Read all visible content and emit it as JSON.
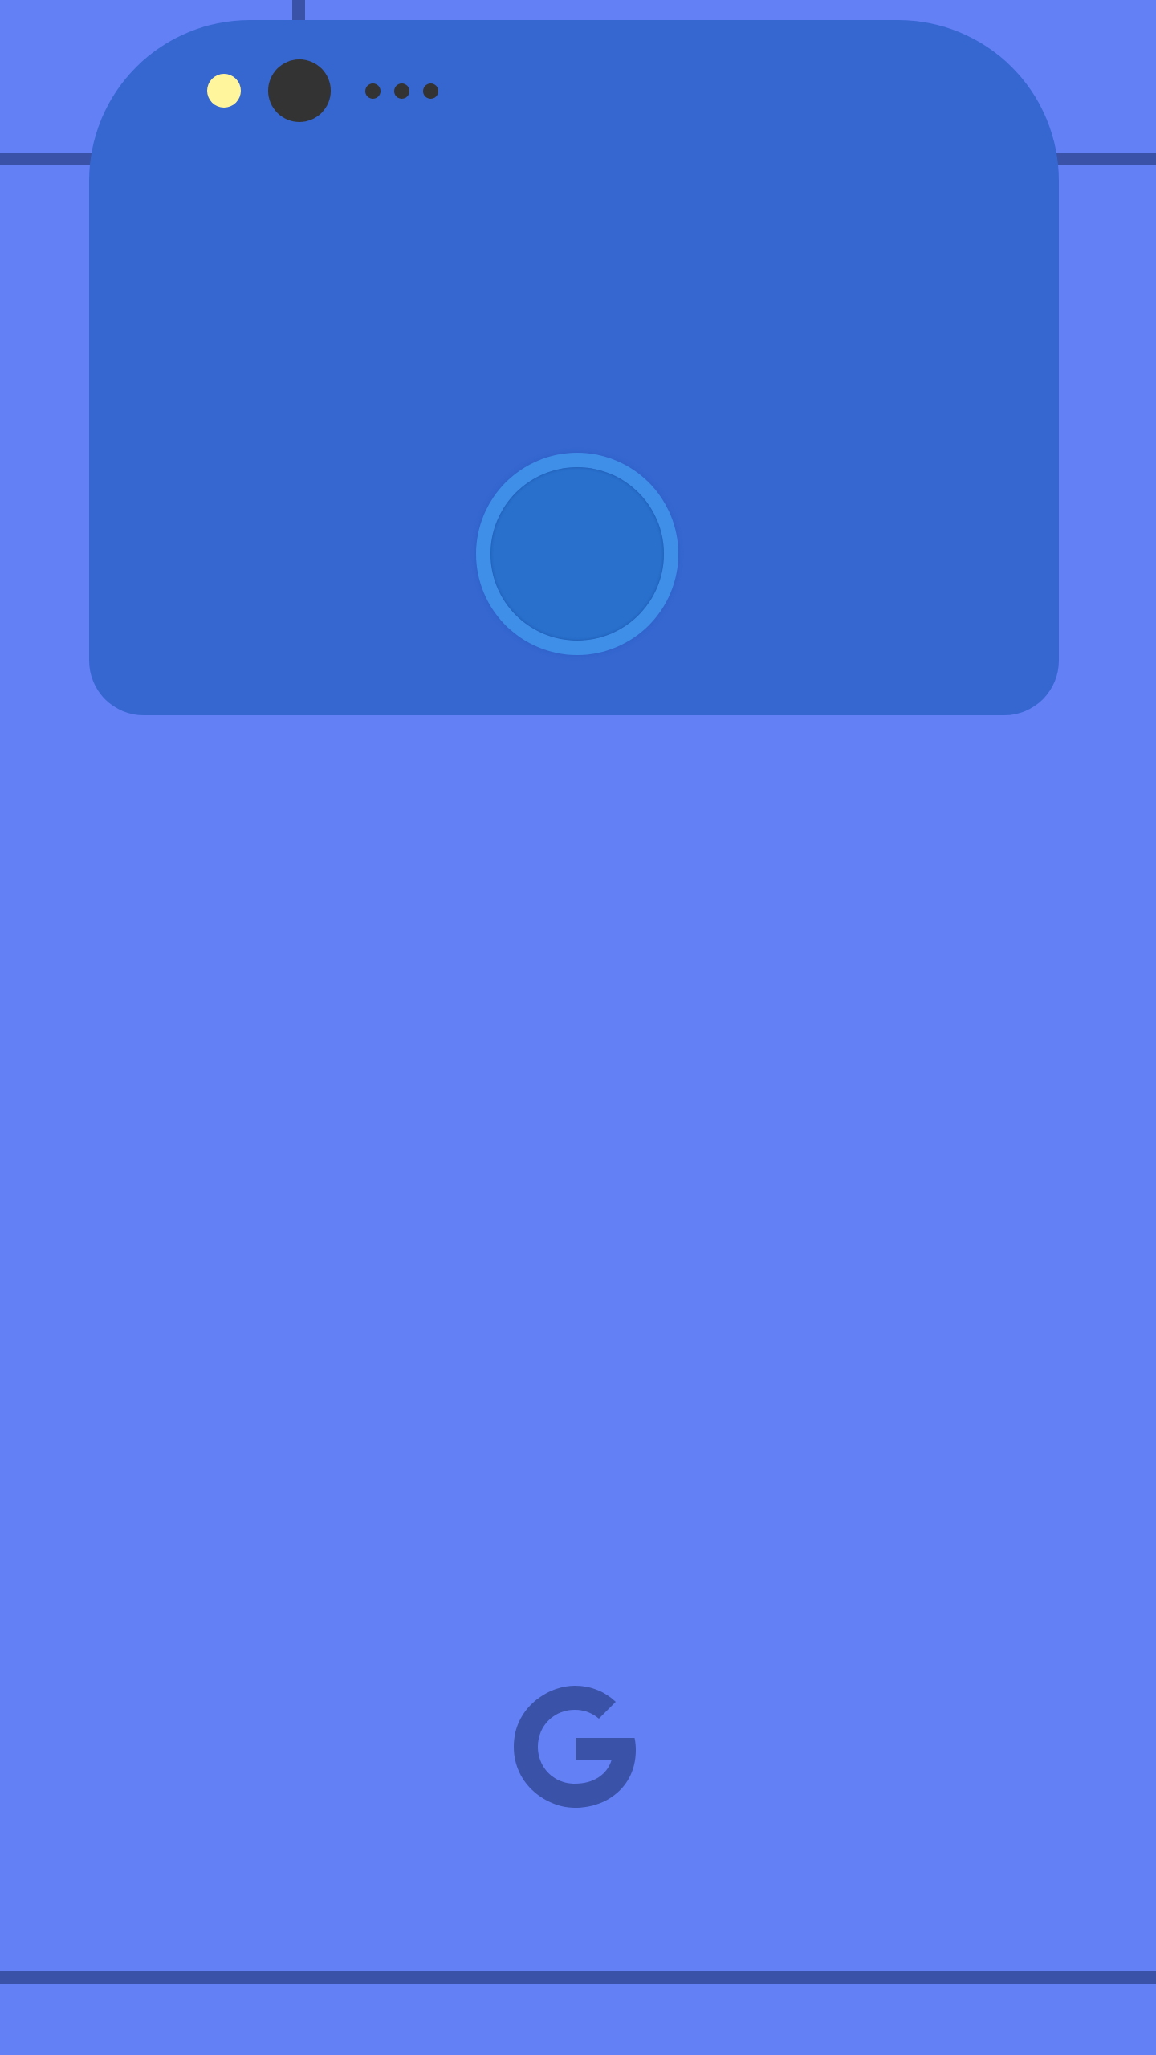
{
  "scene": {
    "description_none": "",
    "colors": {
      "background": "#6380f5",
      "glass_panel": "#3667d1",
      "accent_lines": "#3a52a8",
      "flash": "#fff59d",
      "camera": "#333333",
      "fingerprint_sensor": "#2870cc",
      "logo": "#3a52a8"
    },
    "icons": {
      "logo": "google-g-icon",
      "camera": "camera-lens-icon",
      "flash": "flash-icon",
      "fingerprint": "fingerprint-sensor-icon"
    }
  }
}
